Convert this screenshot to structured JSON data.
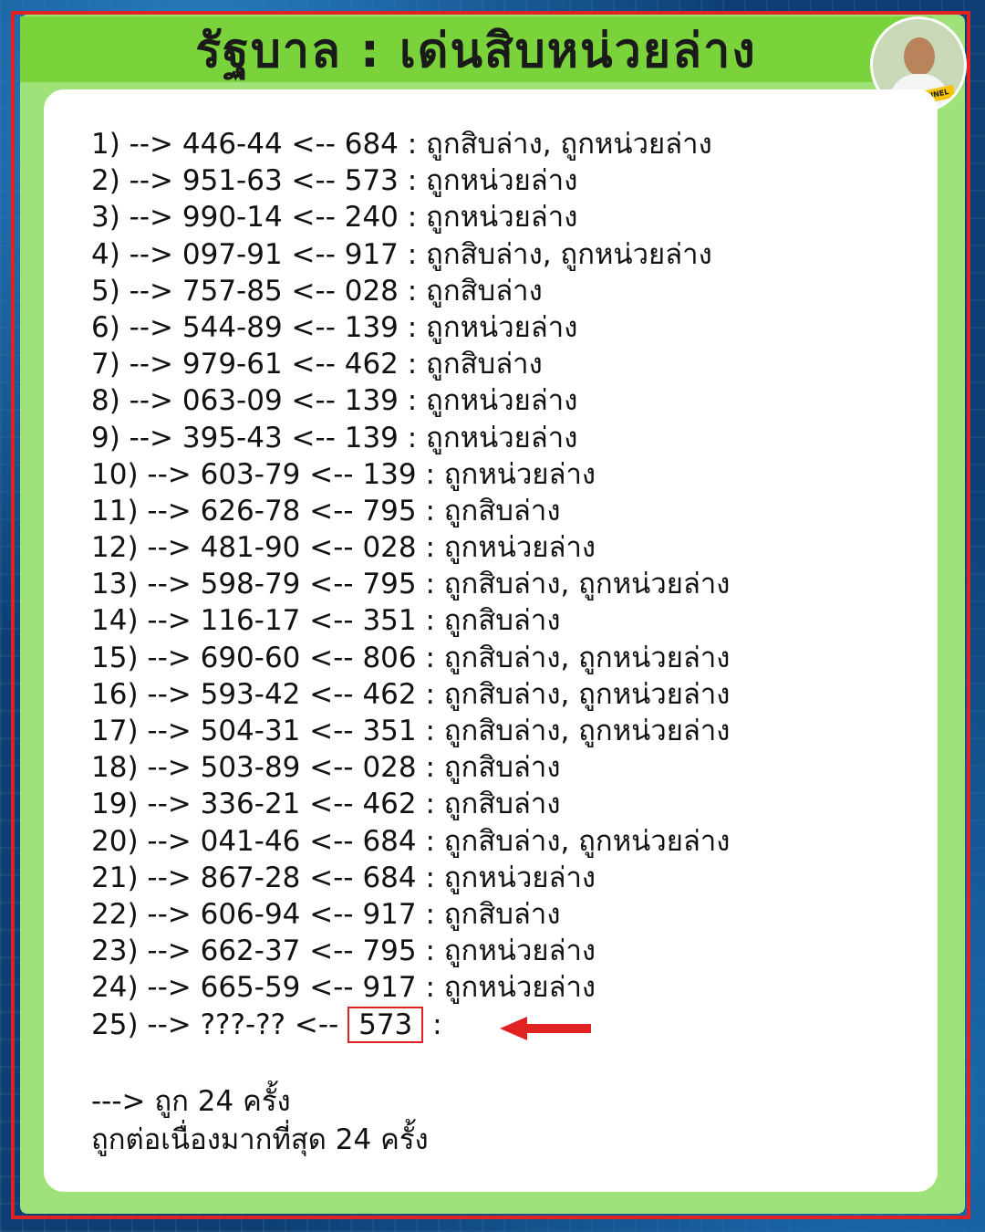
{
  "title": "รัฐบาล : เด่นสิบหน่วยล่าง",
  "avatar_label": "ฤาเดช CHANNEL",
  "rows": [
    "1) --> 446-44 <-- 684 : ถูกสิบล่าง, ถูกหน่วยล่าง",
    "2) --> 951-63 <-- 573 : ถูกหน่วยล่าง",
    "3) --> 990-14 <-- 240 : ถูกหน่วยล่าง",
    "4) --> 097-91 <-- 917 : ถูกสิบล่าง, ถูกหน่วยล่าง",
    "5) --> 757-85 <-- 028 : ถูกสิบล่าง",
    "6) --> 544-89 <-- 139 : ถูกหน่วยล่าง",
    "7) --> 979-61 <-- 462 : ถูกสิบล่าง",
    "8) --> 063-09 <-- 139 : ถูกหน่วยล่าง",
    "9) --> 395-43 <-- 139 : ถูกหน่วยล่าง",
    "10) --> 603-79 <-- 139 : ถูกหน่วยล่าง",
    "11) --> 626-78 <-- 795 : ถูกสิบล่าง",
    "12) --> 481-90 <-- 028 : ถูกหน่วยล่าง",
    "13) --> 598-79 <-- 795 : ถูกสิบล่าง, ถูกหน่วยล่าง",
    "14) --> 116-17 <-- 351 : ถูกสิบล่าง",
    "15) --> 690-60 <-- 806 : ถูกสิบล่าง, ถูกหน่วยล่าง",
    "16) --> 593-42 <-- 462 : ถูกสิบล่าง, ถูกหน่วยล่าง",
    "17) --> 504-31 <-- 351 : ถูกสิบล่าง, ถูกหน่วยล่าง",
    "18) --> 503-89 <-- 028 : ถูกสิบล่าง",
    "19) --> 336-21 <-- 462 : ถูกสิบล่าง",
    "20) --> 041-46 <-- 684 : ถูกสิบล่าง, ถูกหน่วยล่าง",
    "21) --> 867-28 <-- 684 : ถูกหน่วยล่าง",
    "22) --> 606-94 <-- 917 : ถูกสิบล่าง",
    "23) --> 662-37 <-- 795 : ถูกหน่วยล่าง",
    "24) --> 665-59 <-- 917 : ถูกหน่วยล่าง"
  ],
  "last_row": {
    "prefix": "25) --> ???-?? <--",
    "value": "573",
    "suffix": ":"
  },
  "summary": {
    "line1": "---> ถูก 24 ครั้ง",
    "line2": "ถูกต่อเนื่องมากที่สุด 24 ครั้ง"
  },
  "colors": {
    "frame": "#e12222",
    "title_bar": "#7ad33a",
    "panel": "#9fe27a",
    "arrow": "#e12222"
  }
}
